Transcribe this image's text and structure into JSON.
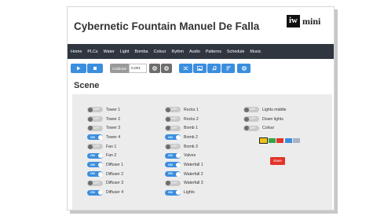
{
  "app": {
    "title": "Cybernetic Fountain Manuel De Falla",
    "logo_box": "iw",
    "logo_text": "mini"
  },
  "nav": [
    "Home",
    "PLCs",
    "Water",
    "Light",
    "Bomba",
    "Colour",
    "Rythm",
    "Audio",
    "Patterns",
    "Schedule",
    "Music"
  ],
  "toolbar": {
    "calibrate_label": "Calibrate",
    "calibrate_value": "0,001"
  },
  "scene": {
    "title": "Scene",
    "columns": [
      [
        {
          "label": "Tower 1",
          "state": "OFF"
        },
        {
          "label": "Tower 2",
          "state": "OFF"
        },
        {
          "label": "Tower 3",
          "state": "OFF"
        },
        {
          "label": "Tower 4",
          "state": "ON"
        },
        {
          "label": "Fan 1",
          "state": "OFF"
        },
        {
          "label": "Fan 2",
          "state": "ON"
        },
        {
          "label": "Diffuser 1",
          "state": "ON"
        },
        {
          "label": "Diffuser 2",
          "state": "ON"
        },
        {
          "label": "Diffuser 3",
          "state": "OFF"
        },
        {
          "label": "Diffuser 4",
          "state": "ON"
        }
      ],
      [
        {
          "label": "Rocks 1",
          "state": "OFF"
        },
        {
          "label": "Rocks 2",
          "state": "OFF"
        },
        {
          "label": "Bomb 1",
          "state": "OFF"
        },
        {
          "label": "Bomb 2",
          "state": "ON"
        },
        {
          "label": "Bomb 3",
          "state": "OFF"
        },
        {
          "label": "Valves",
          "state": "ON"
        },
        {
          "label": "Waterfall 1",
          "state": "ON"
        },
        {
          "label": "Waterfall 2",
          "state": "ON"
        },
        {
          "label": "Waterfall 3",
          "state": "OFF"
        },
        {
          "label": "Lights",
          "state": "ON"
        }
      ],
      [
        {
          "label": "Lights middle",
          "state": "OFF"
        },
        {
          "label": "Down lights",
          "state": "OFF"
        },
        {
          "label": "Colour",
          "state": "OFF"
        }
      ]
    ],
    "swatches": [
      "#f0c419",
      "#3aa14a",
      "#e2342b",
      "#3b8ede",
      "#a8b4c4"
    ],
    "save_label": "Save"
  },
  "colors": {
    "accent": "#3b8ede",
    "navbar": "#2f3640",
    "danger": "#e2342b"
  }
}
